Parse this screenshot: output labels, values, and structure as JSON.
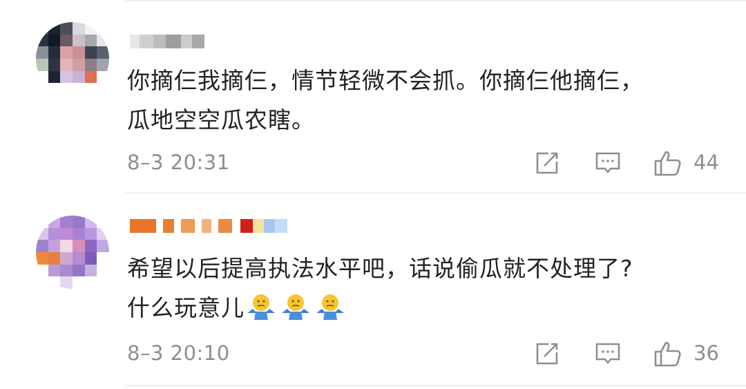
{
  "comments": [
    {
      "content_lines": [
        "你摘仨我摘仨，情节轻微不会抓。你摘仨他摘仨，",
        "瓜地空空瓜农瞎。"
      ],
      "timestamp": "8–3 20:31",
      "like_count": "44"
    },
    {
      "content_lines": [
        "希望以后提高执法水平吧，话说偷瓜就不处理了?",
        "什么玩意儿"
      ],
      "emojis": [
        "shrug-emoji",
        "shrug-emoji",
        "shrug-emoji"
      ],
      "timestamp": "8–3 20:10",
      "like_count": "36"
    }
  ],
  "icons": {
    "share": "share-icon",
    "comment": "comment-icon",
    "like": "thumbs-up-icon"
  },
  "colors": {
    "text": "#222222",
    "meta": "#8e8e8e",
    "icon": "#8e8e8e",
    "divider": "#efefef"
  }
}
